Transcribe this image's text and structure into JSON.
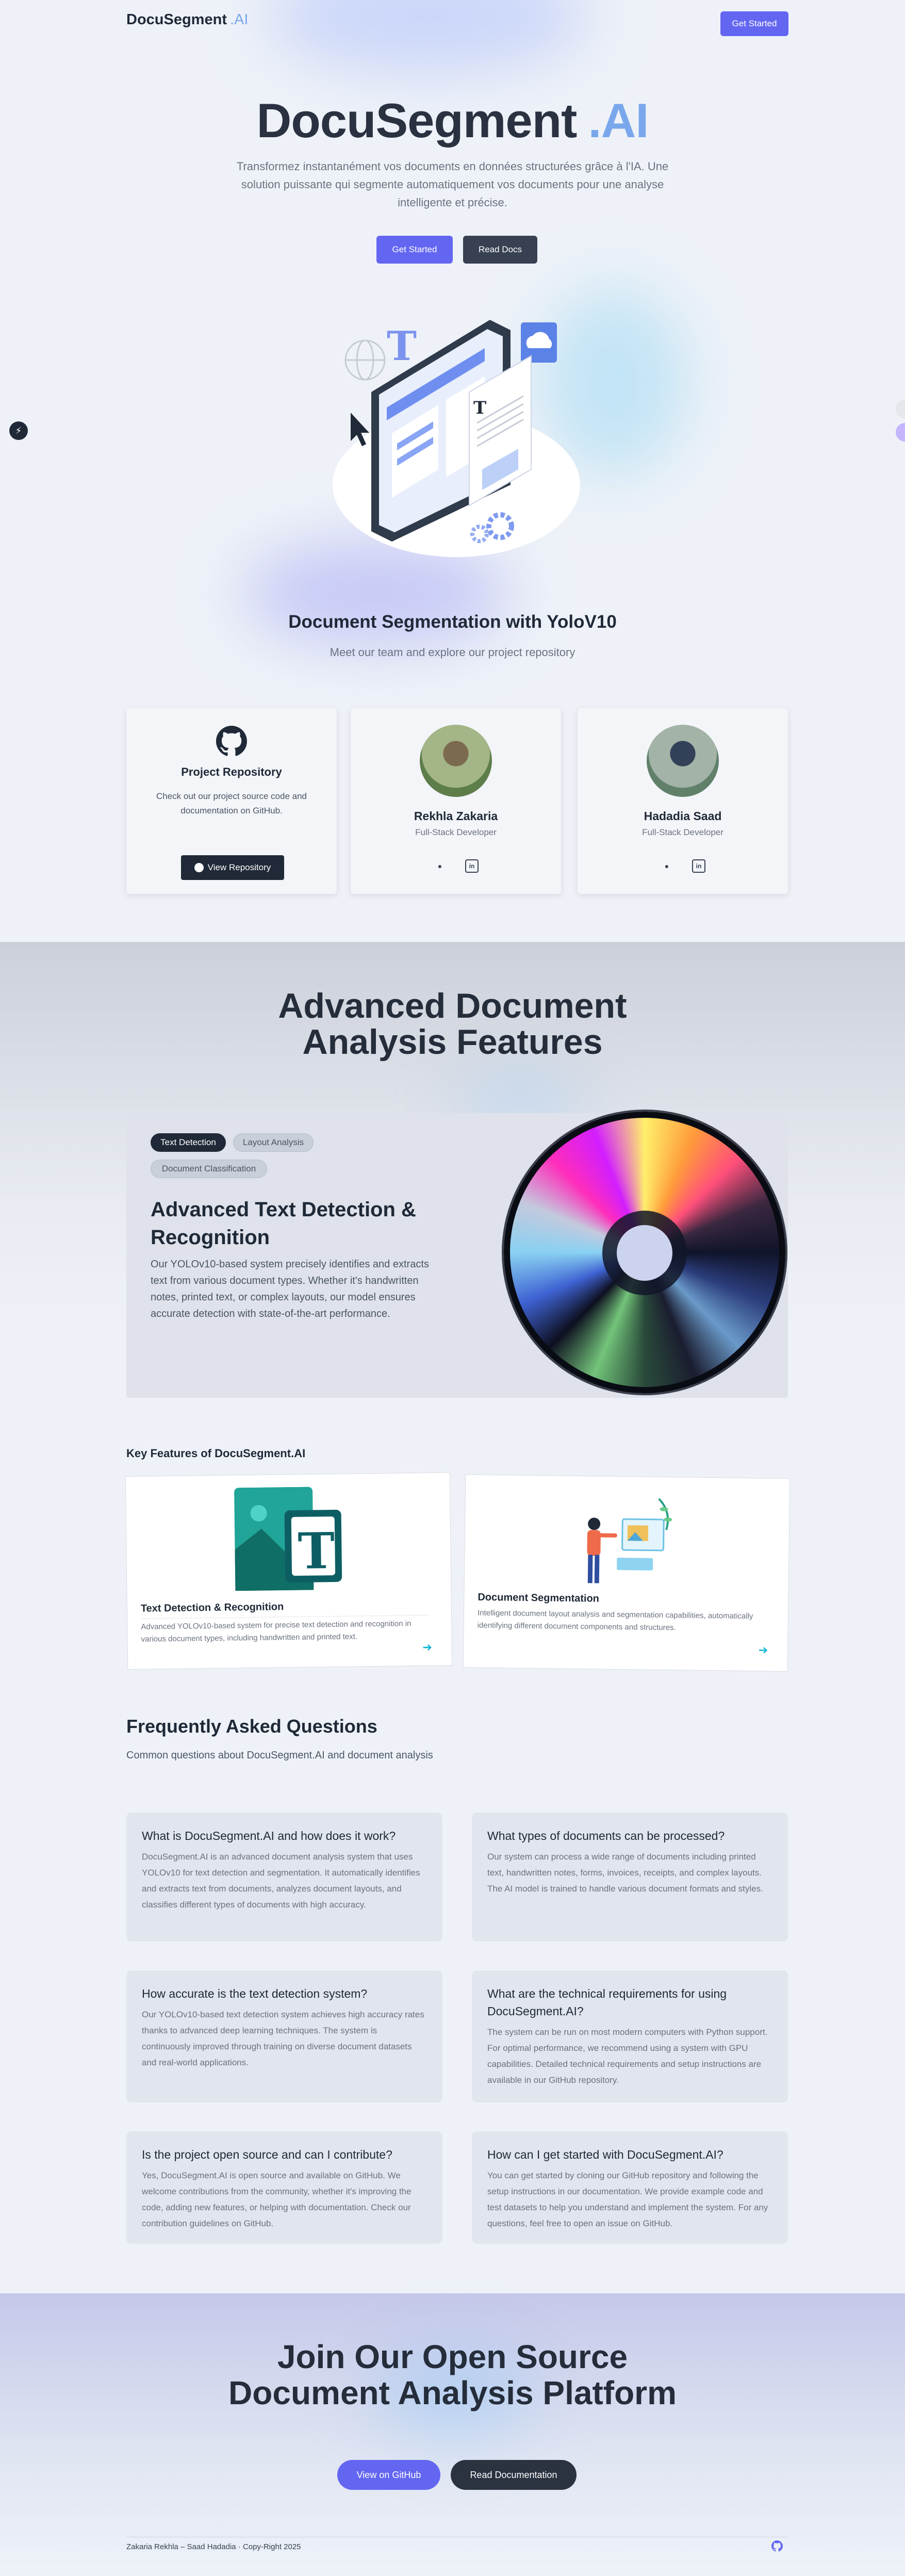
{
  "header": {
    "brand": "DocuSegment",
    "brand_suffix": ".AI",
    "cta": "Get Started"
  },
  "hero": {
    "title": "DocuSegment",
    "title_suffix": ".AI",
    "subtitle": "Transformez instantanément vos documents en données structurées grâce à l'IA. Une solution puissante qui segmente automatiquement vos documents pour une analyse intelligente et précise.",
    "primary_button": "Get Started",
    "secondary_button": "Read Docs"
  },
  "team": {
    "title": "Document Segmentation with YoloV10",
    "subtitle": "Meet our team and explore our project repository",
    "repo_card": {
      "title": "Project Repository",
      "description": "Check out our project source code and documentation on GitHub.",
      "button": "View Repository"
    },
    "members": [
      {
        "name": "Rekhla Zakaria",
        "role": "Full-Stack Developer"
      },
      {
        "name": "Hadadia Saad",
        "role": "Full-Stack Developer"
      }
    ]
  },
  "features": {
    "title_line1": "Advanced Document",
    "title_line2": "Analysis Features",
    "tabs": [
      "Text Detection",
      "Layout Analysis",
      "Document Classification"
    ],
    "active_heading": "Advanced Text Detection & Recognition",
    "active_description": "Our YOLOv10-based system precisely identifies and extracts text from various document types. Whether it's handwritten notes, printed text, or complex layouts, our model ensures accurate detection with state-of-the-art performance."
  },
  "key_features": {
    "title": "Key Features of DocuSegment.AI",
    "cards": [
      {
        "title": "Text Detection & Recognition",
        "description": "Advanced YOLOv10-based system for precise text detection and recognition in various document types, including handwritten and printed text."
      },
      {
        "title": "Document Segmentation",
        "description": "Intelligent document layout analysis and segmentation capabilities, automatically identifying different document components and structures."
      }
    ],
    "arrow": "➔"
  },
  "faq": {
    "title": "Frequently Asked Questions",
    "subtitle": "Common questions about DocuSegment.AI and document analysis",
    "items": [
      {
        "q": "What is DocuSegment.AI and how does it work?",
        "a": "DocuSegment.AI is an advanced document analysis system that uses YOLOv10 for text detection and segmentation. It automatically identifies and extracts text from documents, analyzes document layouts, and classifies different types of documents with high accuracy."
      },
      {
        "q": "What types of documents can be processed?",
        "a": "Our system can process a wide range of documents including printed text, handwritten notes, forms, invoices, receipts, and complex layouts. The AI model is trained to handle various document formats and styles."
      },
      {
        "q": "How accurate is the text detection system?",
        "a": "Our YOLOv10-based text detection system achieves high accuracy rates thanks to advanced deep learning techniques. The system is continuously improved through training on diverse document datasets and real-world applications."
      },
      {
        "q": "What are the technical requirements for using DocuSegment.AI?",
        "a": "The system can be run on most modern computers with Python support. For optimal performance, we recommend using a system with GPU capabilities. Detailed technical requirements and setup instructions are available in our GitHub repository."
      },
      {
        "q": "Is the project open source and can I contribute?",
        "a": "Yes, DocuSegment.AI is open source and available on GitHub. We welcome contributions from the community, whether it's improving the code, adding new features, or helping with documentation. Check our contribution guidelines on GitHub."
      },
      {
        "q": "How can I get started with DocuSegment.AI?",
        "a": "You can get started by cloning our GitHub repository and following the setup instructions in our documentation. We provide example code and test datasets to help you understand and implement the system. For any questions, feel free to open an issue on GitHub."
      }
    ]
  },
  "cta": {
    "title_line1": "Join Our Open Source",
    "title_line2": "Document Analysis Platform",
    "primary_button": "View on GitHub",
    "secondary_button": "Read Documentation"
  },
  "footer": {
    "text": "Zakaria Rekhla – Saad Hadadia · Copy-Right 2025"
  },
  "colors": {
    "accent": "#6366f1",
    "brand_light": "#7aa7ec",
    "dark_button": "#374151"
  }
}
